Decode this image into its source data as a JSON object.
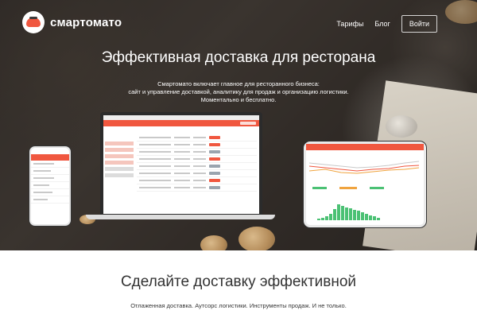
{
  "brand": {
    "name": "смартомато"
  },
  "nav": {
    "pricing": "Тарифы",
    "blog": "Блог",
    "login": "Войти"
  },
  "hero": {
    "title": "Эффективная доставка для ресторана",
    "subtitle_lines": [
      "Смартомато включает главное для ресторанного бизнеса:",
      "сайт и управление доставкой, аналитику для продаж и организацию логистики.",
      "Моментально и бесплатно."
    ]
  },
  "section": {
    "title": "Сделайте доставку эффективной",
    "subtitle": "Отлаженная доставка. Аутсорс логистики. Инструменты продаж. И не только."
  },
  "colors": {
    "accent": "#f0573f",
    "chart_green": "#4bc174"
  }
}
